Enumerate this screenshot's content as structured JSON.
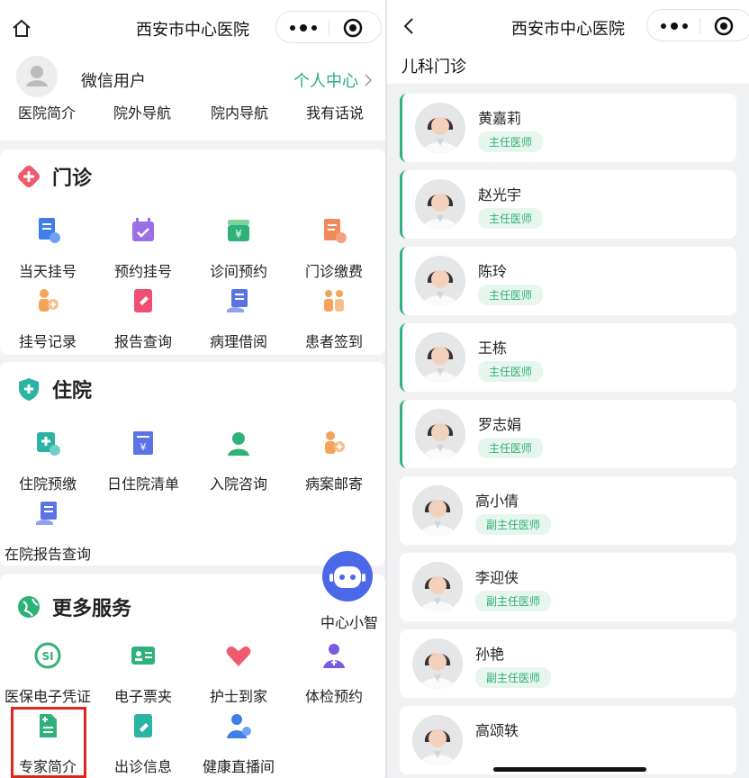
{
  "left": {
    "nav_title": "西安市中心医院",
    "user": {
      "name": "微信用户",
      "center_link": "个人中心"
    },
    "quick_links": [
      "医院简介",
      "院外导航",
      "院内导航",
      "我有话说"
    ],
    "outpatient": {
      "title": "门诊",
      "items": [
        "当天挂号",
        "预约挂号",
        "诊间预约",
        "门诊缴费",
        "挂号记录",
        "报告查询",
        "病理借阅",
        "患者签到"
      ]
    },
    "inpatient": {
      "title": "住院",
      "items": [
        "住院预缴",
        "日住院清单",
        "入院咨询",
        "病案邮寄",
        "在院报告查询"
      ]
    },
    "more": {
      "title": "更多服务",
      "items": [
        "医保电子凭证",
        "电子票夹",
        "护士到家",
        "体检预约",
        "专家简介",
        "出诊信息",
        "健康直播间"
      ]
    },
    "assistant_label": "中心小智"
  },
  "right": {
    "nav_title": "西安市中心医院",
    "dept": "儿科门诊",
    "doctors": [
      {
        "name": "黄嘉莉",
        "title": "主任医师"
      },
      {
        "name": "赵光宇",
        "title": "主任医师"
      },
      {
        "name": "陈玲",
        "title": "主任医师"
      },
      {
        "name": "王栋",
        "title": "主任医师"
      },
      {
        "name": "罗志娟",
        "title": "主任医师"
      },
      {
        "name": "高小倩",
        "title": "副主任医师"
      },
      {
        "name": "李迎侠",
        "title": "副主任医师"
      },
      {
        "name": "孙艳",
        "title": "副主任医师"
      },
      {
        "name": "高颂轶",
        "title": ""
      }
    ]
  },
  "colors": {
    "brand_green": "#26b07a",
    "highlight_red": "#e0261b",
    "bot_blue": "#4b68e8"
  }
}
